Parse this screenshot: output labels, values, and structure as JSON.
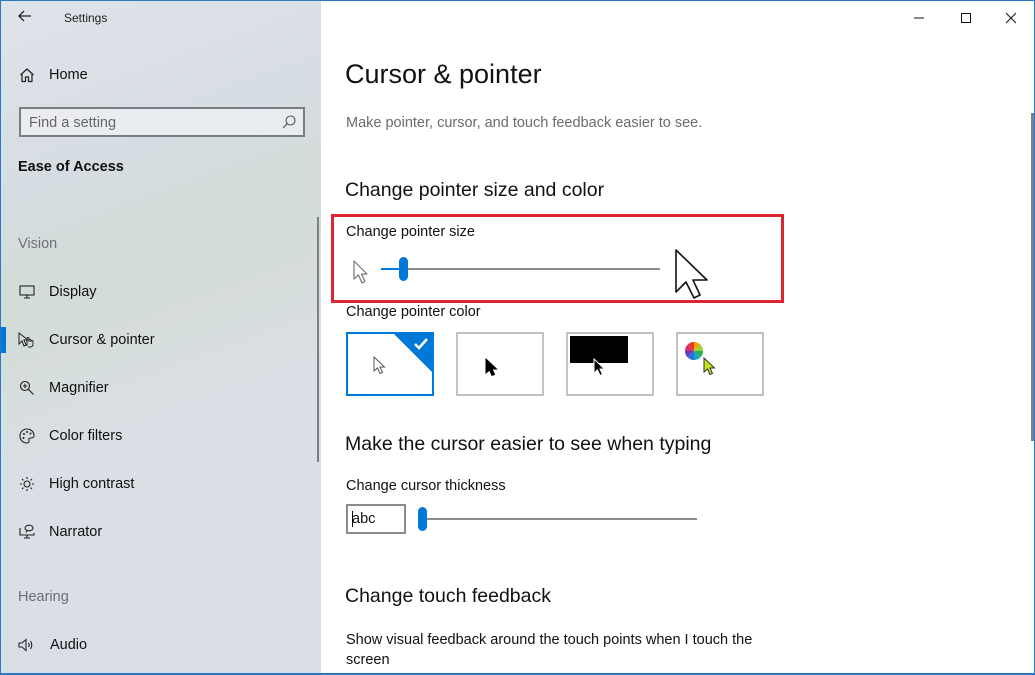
{
  "window": {
    "title": "Settings",
    "controls": {
      "minimize": "minimize-icon",
      "maximize": "maximize-icon",
      "close": "close-icon"
    }
  },
  "sidebar": {
    "back_icon": "back-arrow-icon",
    "home": {
      "label": "Home",
      "icon": "home-icon"
    },
    "search": {
      "placeholder": "Find a setting",
      "value": "",
      "icon": "search-icon"
    },
    "section_title": "Ease of Access",
    "groups": [
      {
        "label": "Vision",
        "items": [
          {
            "label": "Display",
            "icon": "display-icon",
            "active": false
          },
          {
            "label": "Cursor & pointer",
            "icon": "cursor-pointer-icon",
            "active": true
          },
          {
            "label": "Magnifier",
            "icon": "magnifier-icon",
            "active": false
          },
          {
            "label": "Color filters",
            "icon": "color-filters-icon",
            "active": false
          },
          {
            "label": "High contrast",
            "icon": "high-contrast-icon",
            "active": false
          },
          {
            "label": "Narrator",
            "icon": "narrator-icon",
            "active": false
          }
        ]
      },
      {
        "label": "Hearing",
        "items": [
          {
            "label": "Audio",
            "icon": "audio-icon",
            "active": false
          }
        ]
      }
    ]
  },
  "main": {
    "title": "Cursor & pointer",
    "description": "Make pointer, cursor, and touch feedback easier to see.",
    "pointer_section": {
      "heading": "Change pointer size and color",
      "size_label": "Change pointer size",
      "size_value_fraction": 0.08,
      "color_label": "Change pointer color",
      "color_options": [
        {
          "name": "white",
          "selected": true
        },
        {
          "name": "black",
          "selected": false
        },
        {
          "name": "inverted",
          "selected": false
        },
        {
          "name": "custom",
          "selected": false
        }
      ],
      "custom_color": "#c6e21b",
      "accent_color": "#0078d7",
      "highlight_color": "#d9262f"
    },
    "typing_section": {
      "heading": "Make the cursor easier to see when typing",
      "thickness_label": "Change cursor thickness",
      "preview_text": "abc",
      "thickness_value_fraction": 0.0
    },
    "touch_section": {
      "heading": "Change touch feedback",
      "description": "Show visual feedback around the touch points when I touch the screen"
    }
  }
}
